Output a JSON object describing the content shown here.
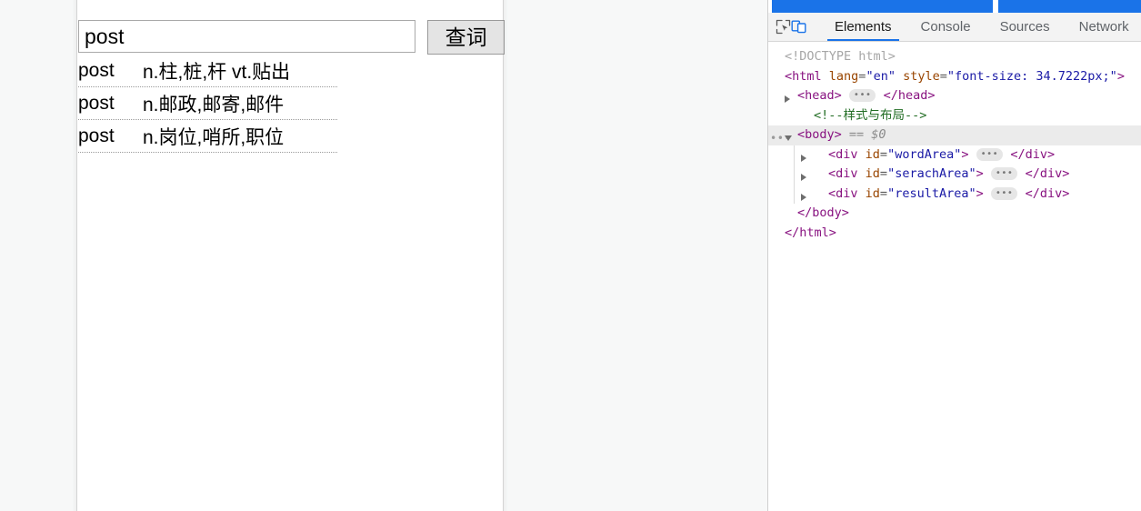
{
  "page": {
    "search": {
      "input_value": "post",
      "input_placeholder": "",
      "button_label": "查词"
    },
    "results": [
      {
        "word": "post",
        "meaning": "n.柱,桩,杆 vt.贴出"
      },
      {
        "word": "post",
        "meaning": "n.邮政,邮寄,邮件"
      },
      {
        "word": "post",
        "meaning": "n.岗位,哨所,职位"
      }
    ]
  },
  "devtools": {
    "icons": {
      "inspect": "inspect-element-icon",
      "device": "device-toolbar-icon"
    },
    "tabs": [
      {
        "label": "Elements",
        "active": true
      },
      {
        "label": "Console",
        "active": false
      },
      {
        "label": "Sources",
        "active": false
      },
      {
        "label": "Network",
        "active": false
      }
    ],
    "dom": {
      "doctype": "<!DOCTYPE html>",
      "html_open_tag": "<html",
      "html_attr_lang_name": "lang",
      "html_attr_lang_value": "\"en\"",
      "html_attr_style_name": "style",
      "html_attr_style_value": "\"font-size: 34.7222px;\"",
      "html_close_bracket": ">",
      "head_open": "<head>",
      "head_close": "</head>",
      "comment": "<!--样式与布局-->",
      "body_open": "<body>",
      "body_ref": "== $0",
      "body_close": "</body>",
      "html_close": "</html>",
      "collapsed_dots": "•••",
      "ellipsis": "•••",
      "divs": [
        {
          "open": "<div",
          "attr": "id",
          "value": "\"wordArea\"",
          "bracket": ">",
          "close": "</div>"
        },
        {
          "open": "<div",
          "attr": "id",
          "value": "\"serachArea\"",
          "bracket": ">",
          "close": "</div>"
        },
        {
          "open": "<div",
          "attr": "id",
          "value": "\"resultArea\"",
          "bracket": ">",
          "close": "</div>"
        }
      ]
    }
  },
  "colors": {
    "accent_blue": "#1a73e8",
    "tag_purple": "#881280",
    "attr_orange": "#994500",
    "value_blue": "#1a1aa6",
    "comment_green": "#236e25"
  }
}
